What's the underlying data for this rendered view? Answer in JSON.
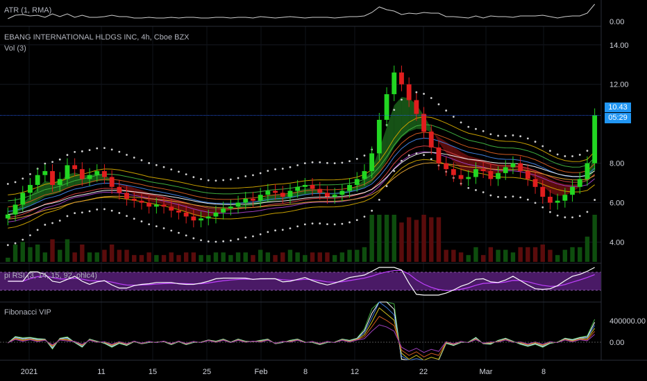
{
  "panes": {
    "atr": {
      "label": "ATR (1, RMA)",
      "axis": [
        "0.00"
      ]
    },
    "main": {
      "title": "EBANG INTERNATIONAL HLDGS INC, 4h, Cboe BZX",
      "vol_label": "Vol (3)",
      "price_ticks": [
        "14.00",
        "12.00",
        "8.00",
        "6.00",
        "4.00"
      ],
      "last_price": "10.43",
      "countdown": "05:29"
    },
    "rsi": {
      "label": "pi RSI (3, 14, 15, 92, ohlc4)"
    },
    "fib": {
      "label": "Fibonacci VIP",
      "axis": [
        "400000.00",
        "0.00"
      ]
    }
  },
  "time_axis": [
    "2021",
    "11",
    "15",
    "25",
    "Feb",
    "8",
    "12",
    "22",
    "Mar",
    "8"
  ],
  "colors": {
    "background": "#000000",
    "up": "#22d622",
    "down": "#e01e1e",
    "price_line": "#2962ff",
    "badge": "#2196f3",
    "rsi_fill": "#5b1f7a",
    "rsi_line": "#ffffff",
    "rsi_signal": "#c040ff",
    "cloud_bull": "#1e6e1e",
    "cloud_bear": "#7a1010",
    "dots": "#cfcfcf"
  },
  "chart_data": {
    "type": "candlestick",
    "symbol": "EBANG INTERNATIONAL HLDGS INC",
    "interval": "4h",
    "exchange": "Cboe BZX",
    "ylim": [
      3.0,
      14.8
    ],
    "last_price": 10.43,
    "closes": [
      5.4,
      5.9,
      6.5,
      6.9,
      7.4,
      7.6,
      6.9,
      7.2,
      7.9,
      7.7,
      7.2,
      7.4,
      7.6,
      7.3,
      6.8,
      6.5,
      6.2,
      6.1,
      6.0,
      5.8,
      5.9,
      5.8,
      5.6,
      5.5,
      5.3,
      5.1,
      5.2,
      5.3,
      5.5,
      5.7,
      5.8,
      6.0,
      6.2,
      6.1,
      6.4,
      6.6,
      6.5,
      6.3,
      6.6,
      6.8,
      6.9,
      6.7,
      6.5,
      6.3,
      6.4,
      6.6,
      6.9,
      7.2,
      7.6,
      8.5,
      10.2,
      11.5,
      12.6,
      12.0,
      11.2,
      10.5,
      9.6,
      8.8,
      8.0,
      7.7,
      7.4,
      7.2,
      7.3,
      7.7,
      7.6,
      7.2,
      7.5,
      7.8,
      8.0,
      7.6,
      7.2,
      6.8,
      6.3,
      6.0,
      6.1,
      6.4,
      6.8,
      7.2,
      8.0,
      10.43
    ]
  }
}
